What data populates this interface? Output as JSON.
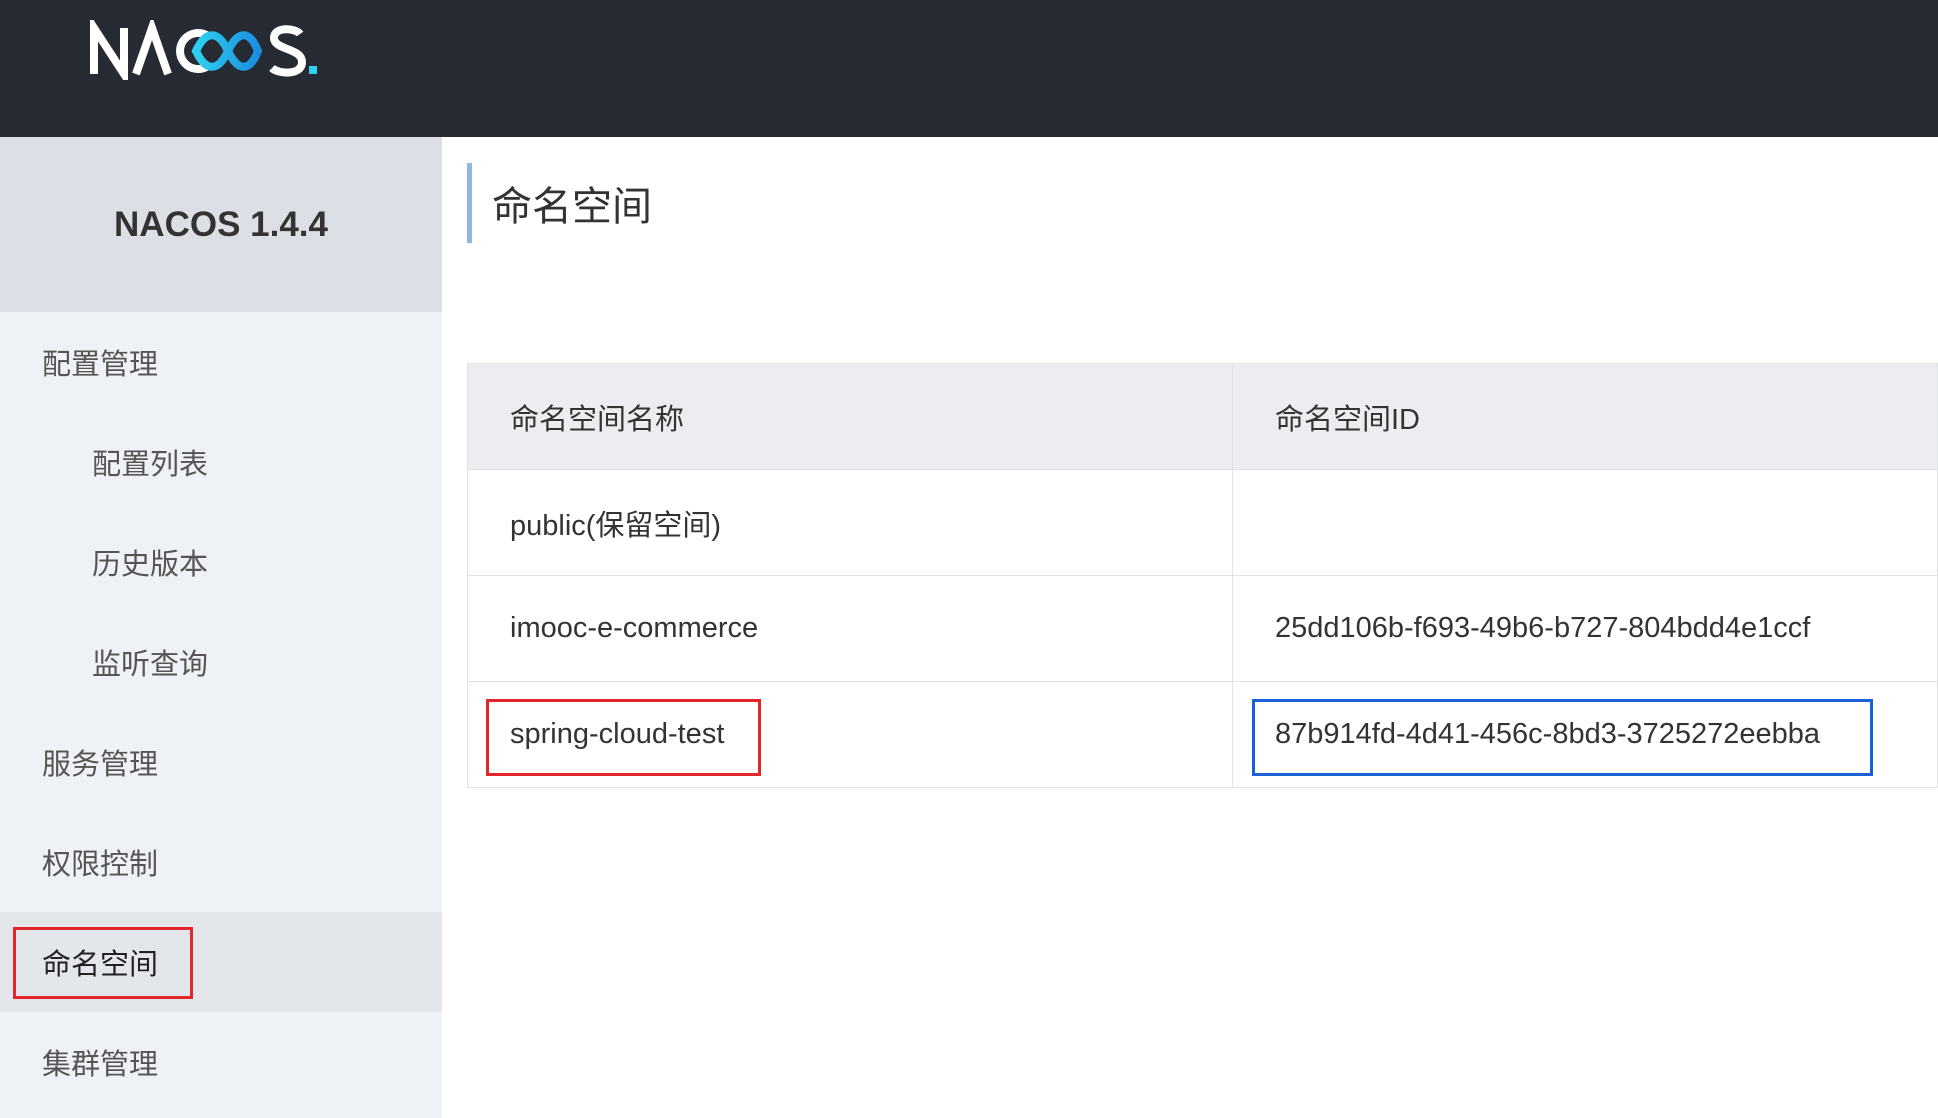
{
  "header": {
    "logo_text": "NACOS.",
    "logo_colors": {
      "letters": "#ffffff",
      "gradient_start": "#2fd0f0",
      "gradient_end": "#1a8fe0"
    }
  },
  "sidebar": {
    "version": "NACOS 1.4.4",
    "items": [
      {
        "label": "配置管理",
        "level": "parent"
      },
      {
        "label": "配置列表",
        "level": "child"
      },
      {
        "label": "历史版本",
        "level": "child"
      },
      {
        "label": "监听查询",
        "level": "child"
      },
      {
        "label": "服务管理",
        "level": "parent"
      },
      {
        "label": "权限控制",
        "level": "parent"
      },
      {
        "label": "命名空间",
        "level": "parent",
        "active": true
      },
      {
        "label": "集群管理",
        "level": "parent"
      }
    ]
  },
  "main": {
    "title": "命名空间",
    "table": {
      "headers": [
        "命名空间名称",
        "命名空间ID"
      ],
      "rows": [
        {
          "name": "public(保留空间)",
          "id": ""
        },
        {
          "name": "imooc-e-commerce",
          "id": "25dd106b-f693-49b6-b727-804bdd4e1ccf"
        },
        {
          "name": "spring-cloud-test",
          "id": "87b914fd-4d41-456c-8bd3-3725272eebba"
        }
      ]
    }
  },
  "annotation_colors": {
    "red": "#e3262a",
    "blue": "#1b62d8"
  }
}
